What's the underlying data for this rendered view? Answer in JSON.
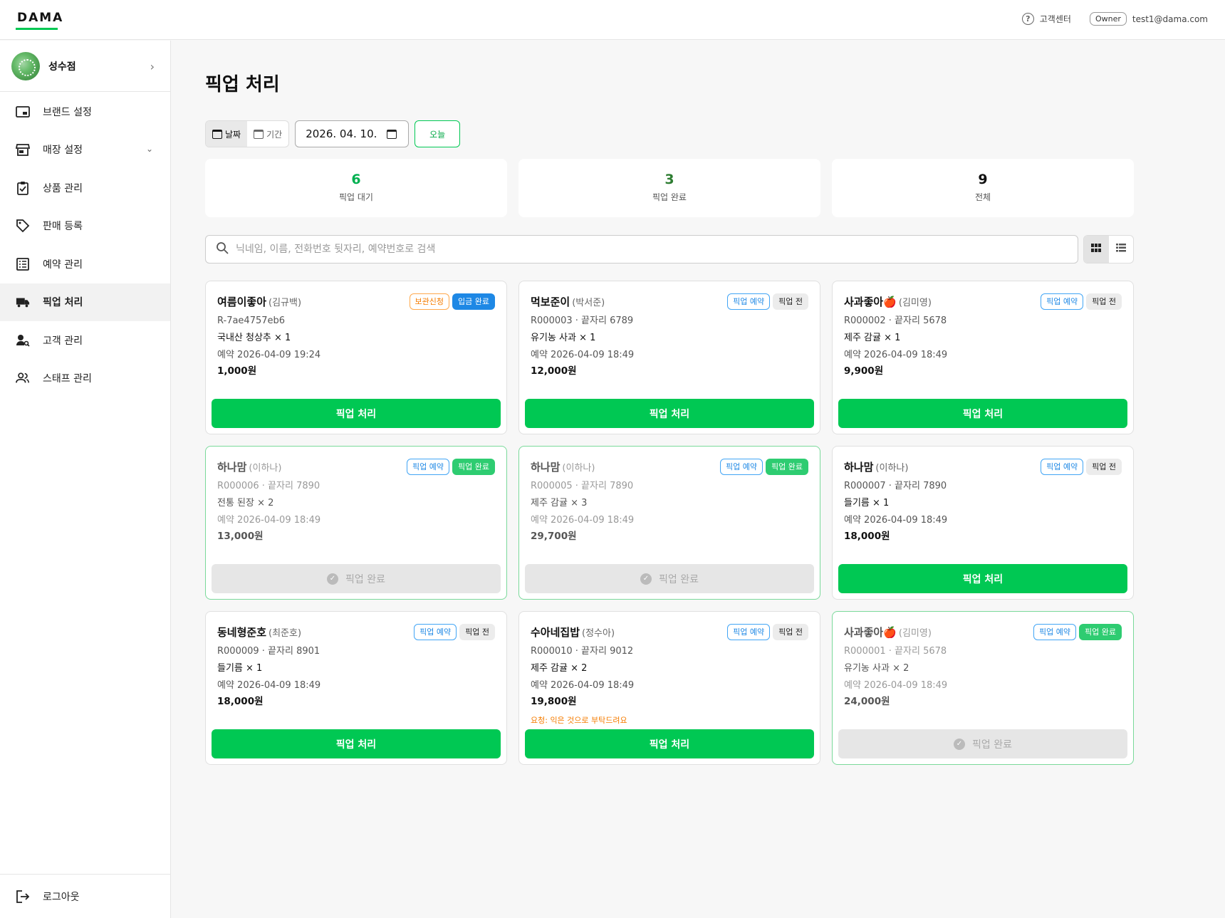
{
  "header": {
    "logo": "DAMA",
    "help_label": "고객센터",
    "role": "Owner",
    "user_email": "test1@dama.com"
  },
  "sidebar": {
    "store_name": "성수점",
    "items": [
      {
        "label": "브랜드 설정",
        "icon": "brand-icon"
      },
      {
        "label": "매장 설정",
        "icon": "store-icon"
      },
      {
        "label": "상품 관리",
        "icon": "clipboard-check-icon"
      },
      {
        "label": "판매 등록",
        "icon": "tag-icon"
      },
      {
        "label": "예약 관리",
        "icon": "list-icon"
      },
      {
        "label": "픽업 처리",
        "icon": "truck-icon"
      },
      {
        "label": "고객 관리",
        "icon": "user-search-icon"
      },
      {
        "label": "스태프 관리",
        "icon": "users-icon"
      }
    ],
    "active": "픽업 처리",
    "logout_label": "로그아웃"
  },
  "main": {
    "title": "픽업 처리",
    "mode_date": "날짜",
    "mode_range": "기간",
    "date_value": "2026. 04. 10.",
    "today_label": "오늘",
    "stats": [
      {
        "value": "6",
        "label": "픽업 대기",
        "color": "#00b050"
      },
      {
        "value": "3",
        "label": "픽업 완료",
        "color": "#2e7d32"
      },
      {
        "value": "9",
        "label": "전체",
        "color": "#111111"
      }
    ],
    "search_placeholder": "닉네임, 이름, 전화번호 뒷자리, 예약번호로 검색"
  },
  "cards": [
    {
      "nick": "여름이좋아",
      "name": "(김규백)",
      "badge1": "보관신청",
      "badge2": "입금 완료",
      "id": "R-7ae4757eb6",
      "item": "국내산 청상추 × 1",
      "time": "예약 2026-04-09 19:24",
      "price": "1,000원",
      "action": "픽업 처리"
    },
    {
      "nick": "먹보준이",
      "name": "(박서준)",
      "badge1": "픽업 예약",
      "badge2": "픽업 전",
      "id": "R000003 · 끝자리 6789",
      "item": "유기농 사과 × 1",
      "time": "예약 2026-04-09 18:49",
      "price": "12,000원",
      "action": "픽업 처리"
    },
    {
      "nick": "사과좋아🍎",
      "name": "(김미영)",
      "badge1": "픽업 예약",
      "badge2": "픽업 전",
      "id": "R000002 · 끝자리 5678",
      "item": "제주 감귤 × 1",
      "time": "예약 2026-04-09 18:49",
      "price": "9,900원",
      "action": "픽업 처리"
    },
    {
      "nick": "하나맘",
      "name": "(이하나)",
      "badge1": "픽업 예약",
      "badge2": "픽업 완료",
      "id": "R000006 · 끝자리 7890",
      "item": "전통 된장 × 2",
      "time": "예약 2026-04-09 18:49",
      "price": "13,000원",
      "action": "픽업 완료"
    },
    {
      "nick": "하나맘",
      "name": "(이하나)",
      "badge1": "픽업 예약",
      "badge2": "픽업 완료",
      "id": "R000005 · 끝자리 7890",
      "item": "제주 감귤 × 3",
      "time": "예약 2026-04-09 18:49",
      "price": "29,700원",
      "action": "픽업 완료"
    },
    {
      "nick": "하나맘",
      "name": "(이하나)",
      "badge1": "픽업 예약",
      "badge2": "픽업 전",
      "id": "R000007 · 끝자리 7890",
      "item": "들기름 × 1",
      "time": "예약 2026-04-09 18:49",
      "price": "18,000원",
      "action": "픽업 처리"
    },
    {
      "nick": "동네형준호",
      "name": "(최준호)",
      "badge1": "픽업 예약",
      "badge2": "픽업 전",
      "id": "R000009 · 끝자리 8901",
      "item": "들기름 × 1",
      "time": "예약 2026-04-09 18:49",
      "price": "18,000원",
      "action": "픽업 처리"
    },
    {
      "nick": "수아네집밥",
      "name": "(정수아)",
      "badge1": "픽업 예약",
      "badge2": "픽업 전",
      "id": "R000010 · 끝자리 9012",
      "item": "제주 감귤 × 2",
      "time": "예약 2026-04-09 18:49",
      "price": "19,800원",
      "request": "요청: 익은 것으로 부탁드려요",
      "action": "픽업 처리"
    },
    {
      "nick": "사과좋아🍎",
      "name": "(김미영)",
      "badge1": "픽업 예약",
      "badge2": "픽업 완료",
      "id": "R000001 · 끝자리 5678",
      "item": "유기농 사과 × 2",
      "time": "예약 2026-04-09 18:49",
      "price": "24,000원",
      "action": "픽업 완료"
    }
  ]
}
